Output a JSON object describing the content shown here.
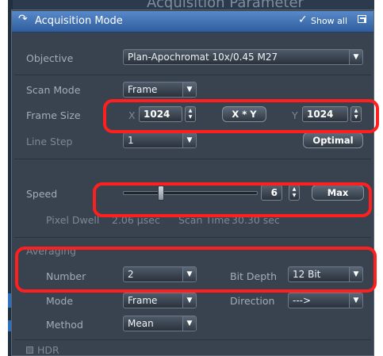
{
  "background": {
    "title": "Acquisition Parameter"
  },
  "panel": {
    "title": "Acquisition Mode",
    "show_all": "Show all"
  },
  "objective": {
    "label": "Objective",
    "value": "Plan-Apochromat 10x/0.45 M27"
  },
  "scan_mode": {
    "label": "Scan Mode",
    "value": "Frame"
  },
  "frame_size": {
    "label": "Frame Size",
    "x_label": "X",
    "x_value": "1024",
    "xy_button": "X * Y",
    "y_label": "Y",
    "y_value": "1024"
  },
  "line_step": {
    "label": "Line Step",
    "value": "1",
    "optimal_button": "Optimal"
  },
  "speed": {
    "label": "Speed",
    "value": "6",
    "max_button": "Max",
    "pixel_dwell_label": "Pixel Dwell",
    "pixel_dwell_value": "2.06 µsec",
    "scan_time_label": "Scan Time",
    "scan_time_value": "30.30 sec"
  },
  "averaging": {
    "section_label": "Averaging",
    "number_label": "Number",
    "number_value": "2",
    "bit_depth_label": "Bit Depth",
    "bit_depth_value": "12 Bit",
    "mode_label": "Mode",
    "mode_value": "Frame",
    "direction_label": "Direction",
    "direction_value": "--->",
    "method_label": "Method",
    "method_value": "Mean"
  },
  "hdr": {
    "label": "HDR",
    "checked": false
  },
  "colors": {
    "panel_bg": "#39434f",
    "title_bar": "#3f6fb0",
    "highlight": "#ff1f1f"
  }
}
